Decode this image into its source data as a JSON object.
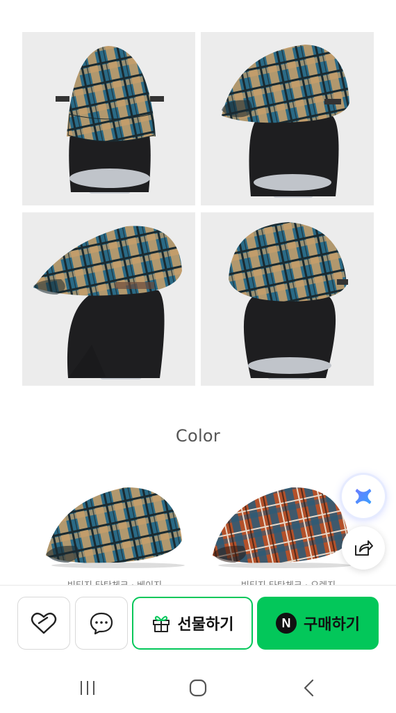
{
  "gallery": {
    "photos": [
      {
        "name": "hat-front-view"
      },
      {
        "name": "hat-side-front-view"
      },
      {
        "name": "hat-side-view"
      },
      {
        "name": "hat-back-view"
      }
    ]
  },
  "color_section": {
    "title": "Color",
    "swatches": [
      {
        "caption": "빈티지 타탄체크 · 베이지",
        "palette": [
          "#2a6a86",
          "#c9a06a",
          "#1a2a30"
        ]
      },
      {
        "caption": "빈티지 타탄체크 · 오렌지",
        "palette": [
          "#b4512a",
          "#2a5a78",
          "#e8d8c8"
        ]
      }
    ]
  },
  "floating": {
    "ai_icon": "sparkle-x-icon",
    "share_icon": "share-icon"
  },
  "bottom_bar": {
    "like_icon": "heart-icon",
    "chat_icon": "chat-bubble-icon",
    "gift_label": "선물하기",
    "buy_label": "구매하기",
    "buy_badge": "N",
    "accent": "#03c75a"
  },
  "nav": {
    "recent_icon": "recent-apps-icon",
    "home_icon": "home-icon",
    "back_icon": "back-icon"
  }
}
